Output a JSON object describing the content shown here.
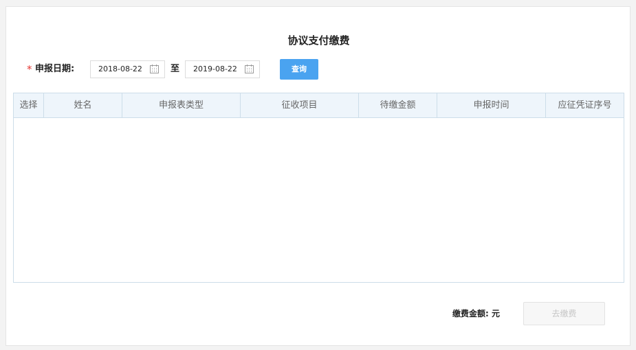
{
  "page": {
    "title": "协议支付缴费"
  },
  "query": {
    "required_mark": "*",
    "date_label": "申报日期:",
    "start_date": "2018-08-22",
    "to_label": "至",
    "end_date": "2019-08-22",
    "calendar_icon": "calendar-icon",
    "search_button": "查询"
  },
  "table": {
    "columns": [
      "选择",
      "姓名",
      "申报表类型",
      "征收项目",
      "待缴金额",
      "申报时间",
      "应征凭证序号"
    ],
    "rows": []
  },
  "footer": {
    "amount_label": "缴费金额:",
    "amount_value": "元",
    "pay_button": "去缴费"
  },
  "colors": {
    "accent": "#4aa3f0",
    "required": "#e53935",
    "table_header_bg": "#eef5fb",
    "table_border": "#ccdde9",
    "disabled_text": "#c6c6c6"
  }
}
